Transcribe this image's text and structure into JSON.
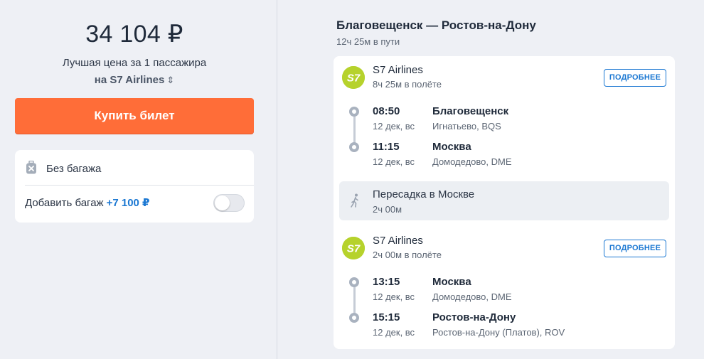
{
  "offer": {
    "price": "34 104 ₽",
    "price_note": "Лучшая цена за 1 пассажира",
    "airline_select": "на S7 Airlines",
    "buy_label": "Купить билет"
  },
  "baggage": {
    "none_label": "Без багажа",
    "add_label": "Добавить багаж",
    "add_price": "+7 100 ₽",
    "toggle_on": false
  },
  "route": {
    "title": "Благовещенск — Ростов-на-Дону",
    "duration": "12ч 25м в пути",
    "segments": [
      {
        "airline": "S7 Airlines",
        "logo_text": "S7",
        "flight_time": "8ч 25м в полёте",
        "details_label": "ПОДРОБНЕЕ",
        "departure": {
          "time": "08:50",
          "date": "12 дек, вс",
          "city": "Благовещенск",
          "airport": "Игнатьево, BQS"
        },
        "arrival": {
          "time": "11:15",
          "date": "12 дек, вс",
          "city": "Москва",
          "airport": "Домодедово, DME"
        }
      },
      {
        "airline": "S7 Airlines",
        "logo_text": "S7",
        "flight_time": "2ч 00м в полёте",
        "details_label": "ПОДРОБНЕЕ",
        "departure": {
          "time": "13:15",
          "date": "12 дек, вс",
          "city": "Москва",
          "airport": "Домодедово, DME"
        },
        "arrival": {
          "time": "15:15",
          "date": "12 дек, вс",
          "city": "Ростов-на-Дону",
          "airport": "Ростов-на-Дону (Платов), ROV"
        }
      }
    ],
    "transfer": {
      "title": "Пересадка в Москве",
      "duration": "2ч 00м"
    }
  },
  "colors": {
    "accent_orange": "#ff6d38",
    "link_blue": "#1a77d2",
    "s7_green": "#b6d22c",
    "background": "#eef0f5"
  },
  "icons": {
    "baggage": "no-baggage-icon",
    "transfer": "walking-person-icon",
    "select": "chevron-up-down-icon"
  }
}
